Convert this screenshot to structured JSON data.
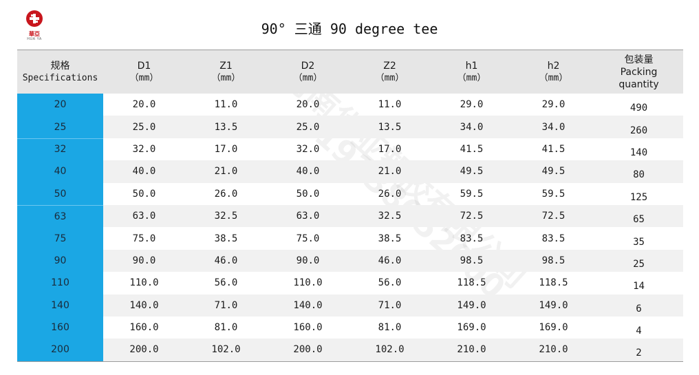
{
  "logo": {
    "cn": "華亞",
    "en": "HUA YA"
  },
  "title": "90° 三通  90 degree tee",
  "table": {
    "headers": [
      {
        "l1": "规格",
        "l2": "Specifications"
      },
      {
        "l1": "D1",
        "l2": "（mm）"
      },
      {
        "l1": "Z1",
        "l2": "（mm）"
      },
      {
        "l1": "D2",
        "l2": "（mm）"
      },
      {
        "l1": "Z2",
        "l2": "（mm）"
      },
      {
        "l1": "h1",
        "l2": "（mm）"
      },
      {
        "l1": "h2",
        "l2": "（mm）"
      },
      {
        "l1": "包装量",
        "l2": "Packing",
        "l3": "quantity"
      }
    ],
    "rows": [
      [
        "20",
        "20.0",
        "11.0",
        "20.0",
        "11.0",
        "29.0",
        "29.0",
        "490"
      ],
      [
        "25",
        "25.0",
        "13.5",
        "25.0",
        "13.5",
        "34.0",
        "34.0",
        "260"
      ],
      [
        "32",
        "32.0",
        "17.0",
        "32.0",
        "17.0",
        "41.5",
        "41.5",
        "140"
      ],
      [
        "40",
        "40.0",
        "21.0",
        "40.0",
        "21.0",
        "49.5",
        "49.5",
        "80"
      ],
      [
        "50",
        "50.0",
        "26.0",
        "50.0",
        "26.0",
        "59.5",
        "59.5",
        "125"
      ],
      [
        "63",
        "63.0",
        "32.5",
        "63.0",
        "32.5",
        "72.5",
        "72.5",
        "65"
      ],
      [
        "75",
        "75.0",
        "38.5",
        "75.0",
        "38.5",
        "83.5",
        "83.5",
        "35"
      ],
      [
        "90",
        "90.0",
        "46.0",
        "90.0",
        "46.0",
        "98.5",
        "98.5",
        "25"
      ],
      [
        "110",
        "110.0",
        "56.0",
        "110.0",
        "56.0",
        "118.5",
        "118.5",
        "14"
      ],
      [
        "140",
        "140.0",
        "71.0",
        "140.0",
        "71.0",
        "149.0",
        "149.0",
        "6"
      ],
      [
        "160",
        "160.0",
        "81.0",
        "160.0",
        "81.0",
        "169.0",
        "169.0",
        "4"
      ],
      [
        "200",
        "200.0",
        "102.0",
        "200.0",
        "102.0",
        "210.0",
        "210.0",
        "2"
      ]
    ]
  },
  "watermark": {
    "company": "河南华亚塑胶有限公司",
    "phone": "19138052000"
  },
  "colors": {
    "spec_column": "#1ba7e4",
    "header_bg": "#e6e6e6",
    "logo_red": "#c8161d"
  }
}
